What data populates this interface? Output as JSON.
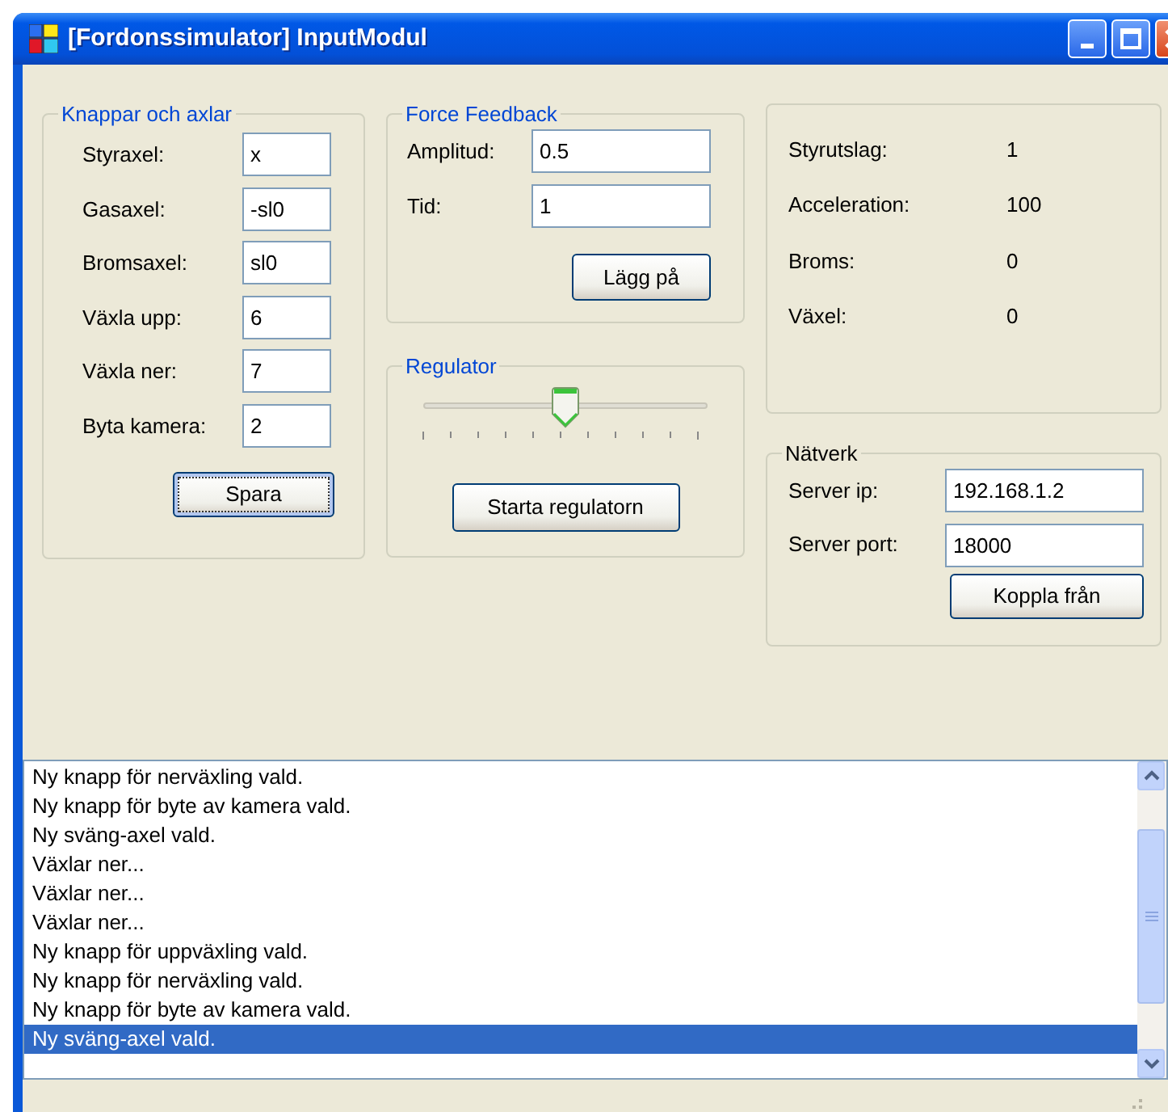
{
  "window": {
    "title": "[Fordonssimulator] InputModul"
  },
  "controls_group": {
    "title": "Knappar och axlar",
    "fields": [
      {
        "label": "Styraxel:",
        "value": "x"
      },
      {
        "label": "Gasaxel:",
        "value": "-sl0"
      },
      {
        "label": "Bromsaxel:",
        "value": "sl0"
      },
      {
        "label": "Växla upp:",
        "value": "6"
      },
      {
        "label": "Växla ner:",
        "value": "7"
      },
      {
        "label": "Byta kamera:",
        "value": "2"
      }
    ],
    "button": {
      "label": "Spara",
      "focused": true
    }
  },
  "force_feedback": {
    "title": "Force Feedback",
    "fields": [
      {
        "label": "Amplitud:",
        "value": "0.5"
      },
      {
        "label": "Tid:",
        "value": "1"
      }
    ],
    "button": {
      "label": "Lägg på",
      "focused": false
    }
  },
  "regulator": {
    "title": "Regulator",
    "slider": {
      "level": 0.5
    },
    "button": {
      "label": "Starta regulatorn",
      "focused": false
    }
  },
  "readings": [
    {
      "label": "Styrutslag:",
      "value": "1"
    },
    {
      "label": "Acceleration:",
      "value": "100"
    },
    {
      "label": "Broms:",
      "value": "0"
    },
    {
      "label": "Växel:",
      "value": "0"
    }
  ],
  "network": {
    "title": "Nätverk",
    "fields": [
      {
        "label": "Server ip:",
        "value": "192.168.1.2"
      },
      {
        "label": "Server port:",
        "value": "18000"
      }
    ],
    "button": {
      "label": "Koppla från",
      "focused": false
    }
  },
  "log": [
    {
      "text": "Ny knapp för nerväxling vald.",
      "selected": false
    },
    {
      "text": "Ny knapp för byte av kamera vald.",
      "selected": false
    },
    {
      "text": "Ny sväng-axel vald.",
      "selected": false
    },
    {
      "text": "Växlar ner...",
      "selected": false
    },
    {
      "text": "Växlar ner...",
      "selected": false
    },
    {
      "text": "Växlar ner...",
      "selected": false
    },
    {
      "text": "Ny knapp för uppväxling vald.",
      "selected": false
    },
    {
      "text": "Ny knapp för nerväxling vald.",
      "selected": false
    },
    {
      "text": "Ny knapp för byte av kamera vald.",
      "selected": false
    },
    {
      "text": "Ny sväng-axel vald.",
      "selected": true
    }
  ]
}
